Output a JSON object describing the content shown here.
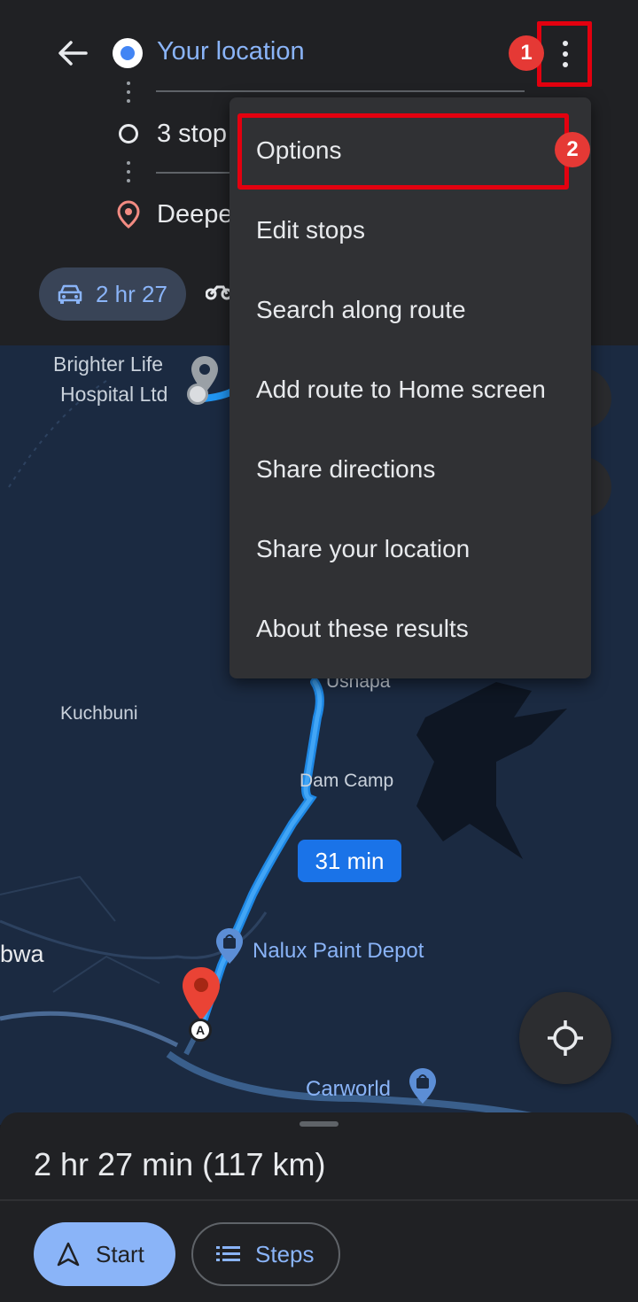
{
  "header": {
    "origin": "Your location",
    "stops": "3 stop",
    "destination": "Deepe",
    "mode_time": "2 hr 27"
  },
  "menu": {
    "items": [
      "Options",
      "Edit stops",
      "Search along route",
      "Add route to Home screen",
      "Share directions",
      "Share your location",
      "About these results"
    ]
  },
  "annotations": {
    "badge_1": "1",
    "badge_2": "2"
  },
  "map": {
    "labels": {
      "hospital": "Brighter Life Hospital Ltd",
      "hospital_line1": "Brighter Life",
      "hospital_line2": "Hospital Ltd",
      "kuchbuni": "Kuchbuni",
      "ushapa": "Ushapa",
      "dam_camp": "Dam Camp",
      "bwa": "bwa",
      "nalux": "Nalux Paint Depot",
      "carworld": "Carworld"
    },
    "route_time": "31 min"
  },
  "sheet": {
    "summary": "2 hr 27 min (117 km)",
    "start_label": "Start",
    "steps_label": "Steps"
  },
  "colors": {
    "accent": "#8ab4f8",
    "route": "#2196f3",
    "highlight": "#e3000f",
    "map_bg": "#1b2a41"
  }
}
